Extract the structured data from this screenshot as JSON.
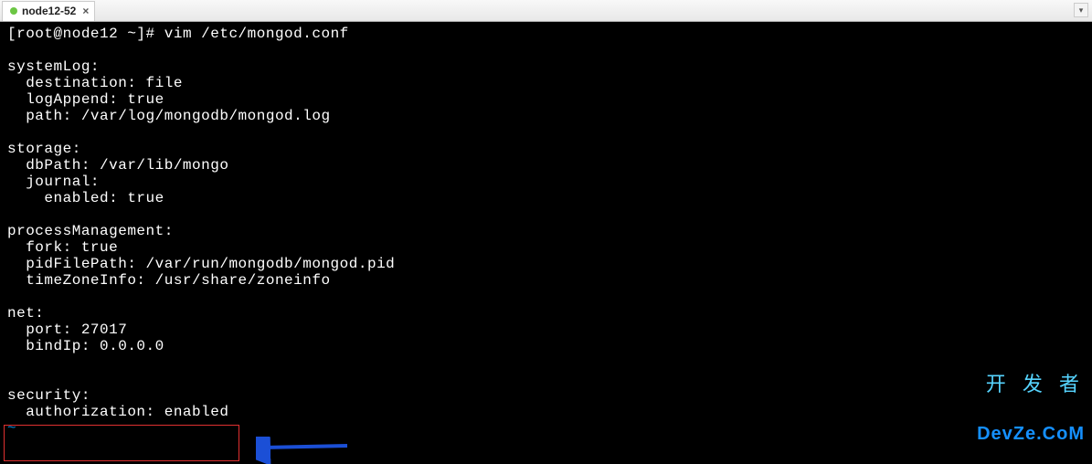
{
  "tab": {
    "label": "node12-52",
    "close": "×"
  },
  "menu_glyph": "▾",
  "terminal": {
    "prompt": "[root@node12 ~]# ",
    "command": "vim /etc/mongod.conf",
    "lines": [
      "",
      "systemLog:",
      "  destination: file",
      "  logAppend: true",
      "  path: /var/log/mongodb/mongod.log",
      "",
      "storage:",
      "  dbPath: /var/lib/mongo",
      "  journal:",
      "    enabled: true",
      "",
      "processManagement:",
      "  fork: true",
      "  pidFilePath: /var/run/mongodb/mongod.pid",
      "  timeZoneInfo: /usr/share/zoneinfo",
      "",
      "net:",
      "  port: 27017",
      "  bindIp: 0.0.0.0",
      "",
      "",
      "security:"
    ],
    "highlighted_line": "  authorization: enabled",
    "tilde": "~"
  },
  "watermark": {
    "line1": "开 发 者",
    "line2": "DevZe.CoM"
  },
  "annotation": {
    "arrow_color": "#1b4fd6",
    "highlight_color": "#e03030"
  }
}
